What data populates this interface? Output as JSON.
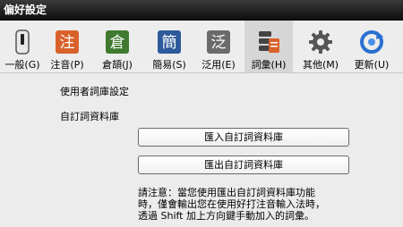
{
  "window": {
    "title": "偏好設定"
  },
  "toolbar": {
    "items": [
      {
        "label": "一般(G)",
        "icon": "switch-icon"
      },
      {
        "label": "注音(P)",
        "icon": "zhuyin-icon",
        "glyph": "注"
      },
      {
        "label": "倉頡(J)",
        "icon": "cangjie-icon",
        "glyph": "倉"
      },
      {
        "label": "簡易(S)",
        "icon": "simplex-icon",
        "glyph": "簡"
      },
      {
        "label": "泛用(E)",
        "icon": "generic-icon",
        "glyph": "泛"
      },
      {
        "label": "詞彙(H)",
        "icon": "phrase-database-icon",
        "active": true
      },
      {
        "label": "其他(M)",
        "icon": "gear-icon"
      },
      {
        "label": "更新(U)",
        "icon": "update-icon"
      }
    ]
  },
  "main": {
    "section_title": "使用者詞庫設定",
    "subsection_title": "自訂詞資料庫",
    "import_button": "匯入自訂詞資料庫",
    "export_button": "匯出自訂詞資料庫",
    "note_lines": [
      "請注意：當您使用匯出自訂詞資料庫功能",
      "時，僅會輸出您在使用好打注音輸入法時，",
      "透過 Shift 加上方向鍵手動加入的詞彙。"
    ]
  },
  "colors": {
    "titlebar": "#1a1a1a",
    "zhuyin": "#d9622b",
    "cangjie": "#3f7a2f",
    "simplex": "#2d5a9a",
    "generic": "#6b6b6b",
    "update": "#2a6fd0"
  }
}
